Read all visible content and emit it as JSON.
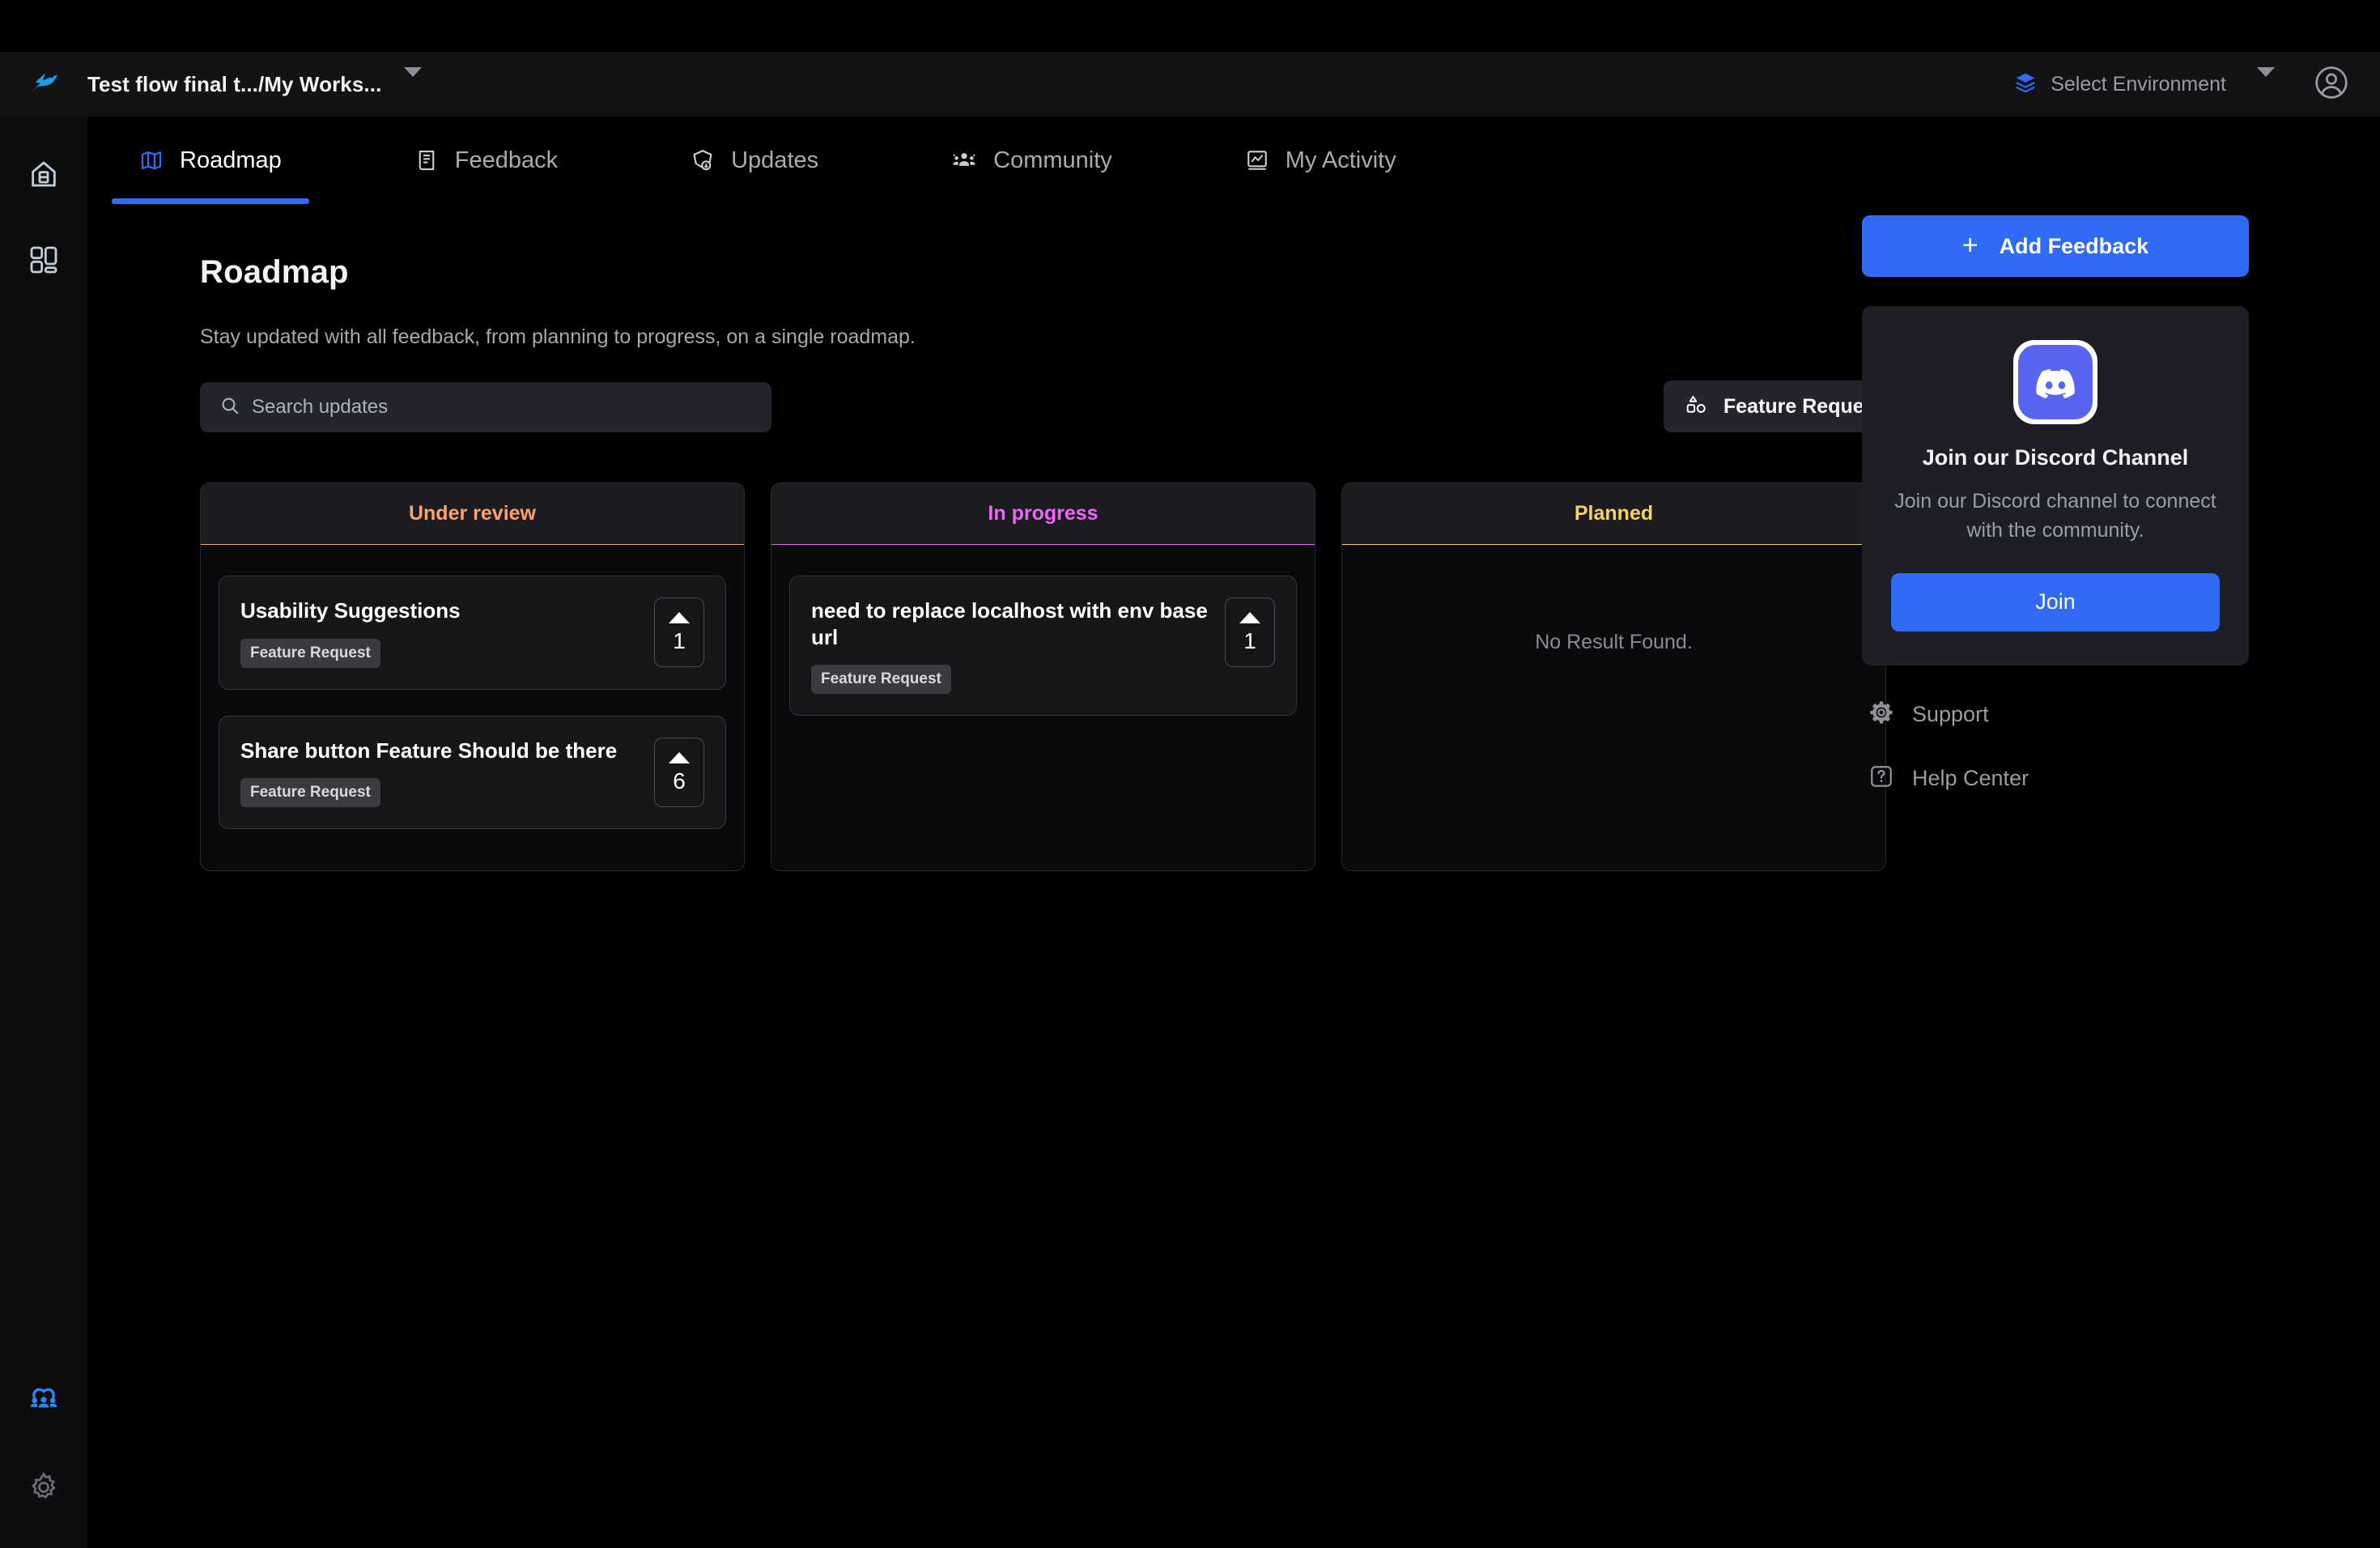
{
  "window": {
    "logo_icon": "bird-logo-icon",
    "breadcrumb": "Test flow final t.../My Works...",
    "breadcrumb_caret_icon": "chevron-down-icon"
  },
  "topbar": {
    "environment": {
      "icon": "layers-icon",
      "label": "Select Environment",
      "caret_icon": "chevron-down-icon"
    },
    "account_icon": "user-circle-icon"
  },
  "rail": {
    "items": [
      {
        "name": "home",
        "icon": "home-icon",
        "active": false
      },
      {
        "name": "dashboard",
        "icon": "layout-grid-icon",
        "active": false
      },
      {
        "name": "community",
        "icon": "users-group-icon",
        "active": true
      },
      {
        "name": "settings",
        "icon": "gear-icon",
        "active": false
      }
    ]
  },
  "tabs": [
    {
      "label": "Roadmap",
      "icon": "map-icon",
      "active": true
    },
    {
      "label": "Feedback",
      "icon": "feedback-note-icon",
      "active": false
    },
    {
      "label": "Updates",
      "icon": "updates-badge-icon",
      "active": false
    },
    {
      "label": "Community",
      "icon": "people-icon",
      "active": false
    },
    {
      "label": "My Activity",
      "icon": "activity-chart-icon",
      "active": false
    }
  ],
  "main": {
    "title": "Roadmap",
    "subtitle": "Stay updated with all feedback, from planning to progress, on a single roadmap.",
    "search": {
      "icon": "search-icon",
      "placeholder": "Search updates",
      "value": ""
    },
    "filter": {
      "icon": "shapes-icon",
      "selected": "Feature Request",
      "caret_icon": "chevron-down-icon"
    }
  },
  "board": {
    "columns": [
      {
        "title": "Under review",
        "color": "#f9a26c",
        "empty_message": "",
        "cards": [
          {
            "title": "Usability Suggestions",
            "tag": "Feature Request",
            "votes": "1",
            "upvote_icon": "caret-up-icon"
          },
          {
            "title": "Share button Feature Should be there",
            "tag": "Feature Request",
            "votes": "6",
            "upvote_icon": "caret-up-icon"
          }
        ]
      },
      {
        "title": "In progress",
        "color": "#e968f7",
        "empty_message": "",
        "cards": [
          {
            "title": "need to replace localhost with env base url",
            "tag": "Feature Request",
            "votes": "1",
            "upvote_icon": "caret-up-icon"
          }
        ]
      },
      {
        "title": "Planned",
        "color": "#f5d264",
        "empty_message": "No Result Found.",
        "cards": []
      }
    ]
  },
  "sidebar": {
    "add_feedback": {
      "label": "Add Feedback",
      "icon": "plus-icon"
    },
    "discord": {
      "logo_icon": "discord-icon",
      "title": "Join our Discord Channel",
      "description": "Join our Discord channel to connect with the community.",
      "button_label": "Join"
    },
    "links": [
      {
        "label": "Support",
        "icon": "gear-icon"
      },
      {
        "label": "Help Center",
        "icon": "question-box-icon"
      }
    ]
  },
  "colors": {
    "accent_blue": "#2f6bf5",
    "discord_blurple": "#5865f2",
    "under_review": "#f9a26c",
    "in_progress": "#e968f7",
    "planned": "#f5d264",
    "page_bg": "#000000",
    "panel_bg": "#1d1e26"
  }
}
